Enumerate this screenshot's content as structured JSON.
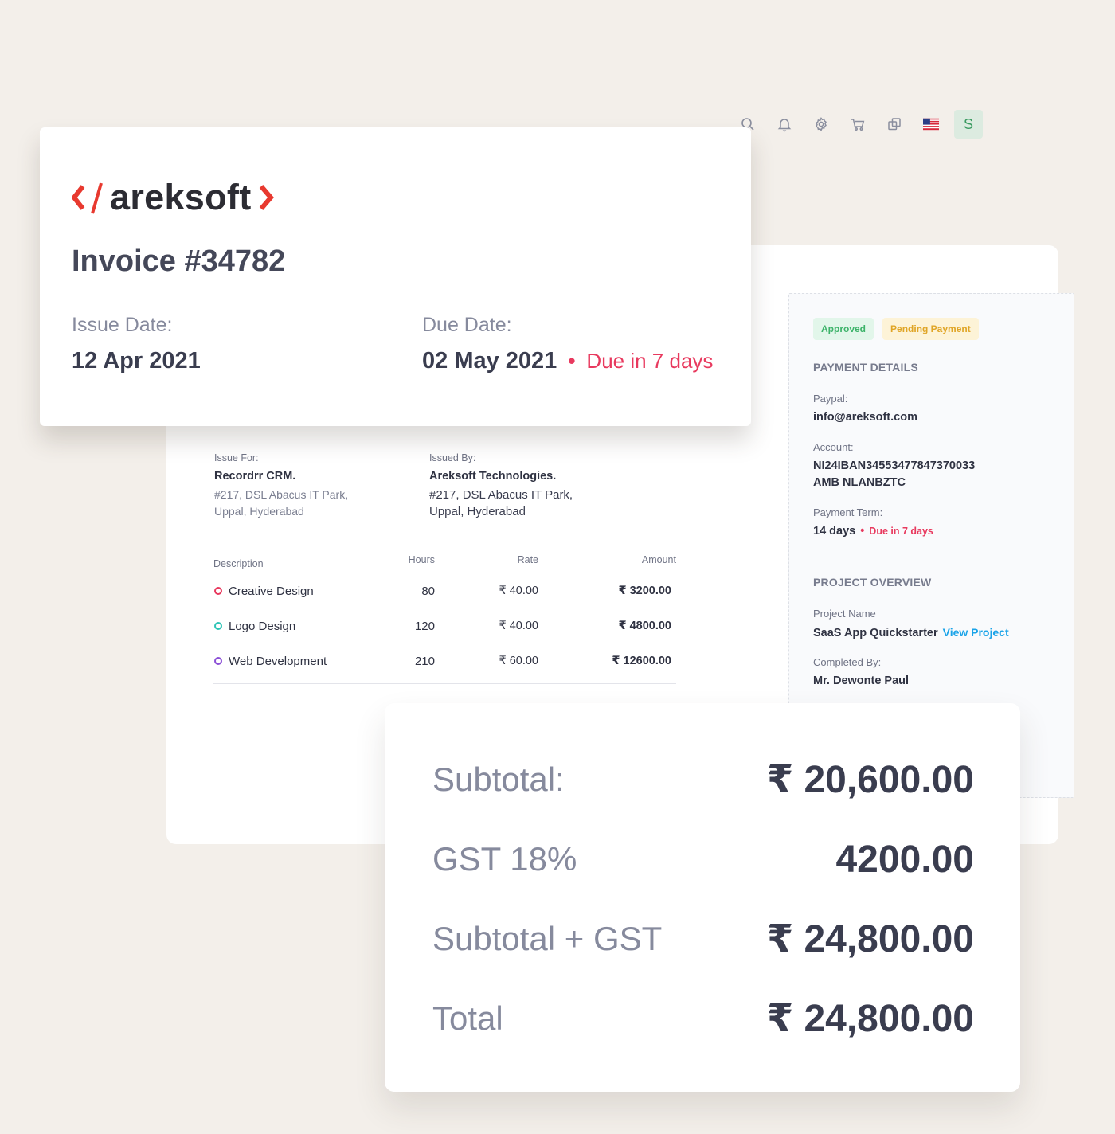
{
  "toolbar": {
    "icons": [
      "search-icon",
      "bell-icon",
      "gear-icon",
      "cart-icon",
      "copy-icon",
      "us-flag-icon"
    ],
    "avatar_initial": "S"
  },
  "header": {
    "logo": {
      "open": "</",
      "name": "areksoft",
      "close": ">"
    },
    "invoice_title": "Invoice #34782",
    "issue_date_label": "Issue Date:",
    "issue_date": "12 Apr 2021",
    "due_date_label": "Due Date:",
    "due_date": "02 May 2021",
    "due_note": "Due in 7 days"
  },
  "parties": {
    "issue_for": {
      "label": "Issue For:",
      "name": "Recordrr CRM.",
      "address_line1": "#217, DSL Abacus IT Park,",
      "address_line2": "Uppal, Hyderabad"
    },
    "issued_by": {
      "label": "Issued By:",
      "name": "Areksoft Technologies.",
      "address_line1": "#217, DSL Abacus IT Park,",
      "address_line2": "Uppal, Hyderabad"
    }
  },
  "items": {
    "headers": {
      "description": "Description",
      "hours": "Hours",
      "rate": "Rate",
      "amount": "Amount"
    },
    "rows": [
      {
        "description": "Creative Design",
        "hours": "80",
        "rate": "₹ 40.00",
        "amount": "₹ 3200.00",
        "color": "#e8395e"
      },
      {
        "description": "Logo Design",
        "hours": "120",
        "rate": "₹ 40.00",
        "amount": "₹ 4800.00",
        "color": "#2ec4b6"
      },
      {
        "description": "Web Development",
        "hours": "210",
        "rate": "₹ 60.00",
        "amount": "₹ 12600.00",
        "color": "#8b4fd6"
      }
    ]
  },
  "sidebar": {
    "badges": {
      "approved": "Approved",
      "pending": "Pending Payment"
    },
    "payment_details_title": "PAYMENT DETAILS",
    "paypal_label": "Paypal:",
    "paypal_value": "info@areksoft.com",
    "account_label": "Account:",
    "account_line1": "NI24IBAN34553477847370033",
    "account_line2": "AMB NLANBZTC",
    "term_label": "Payment Term:",
    "term_value": "14 days",
    "term_due": "Due in 7 days",
    "project_overview_title": "PROJECT OVERVIEW",
    "project_name_label": "Project Name",
    "project_name": "SaaS App Quickstarter",
    "view_project": "View Project",
    "completed_by_label": "Completed By:",
    "completed_by": "Mr. Dewonte Paul"
  },
  "totals": {
    "subtotal_label": "Subtotal:",
    "subtotal": "₹ 20,600.00",
    "gst_label": "GST 18%",
    "gst": "4200.00",
    "subtotal_gst_label": "Subtotal + GST",
    "subtotal_gst": "₹ 24,800.00",
    "total_label": "Total",
    "total": "₹ 24,800.00"
  }
}
